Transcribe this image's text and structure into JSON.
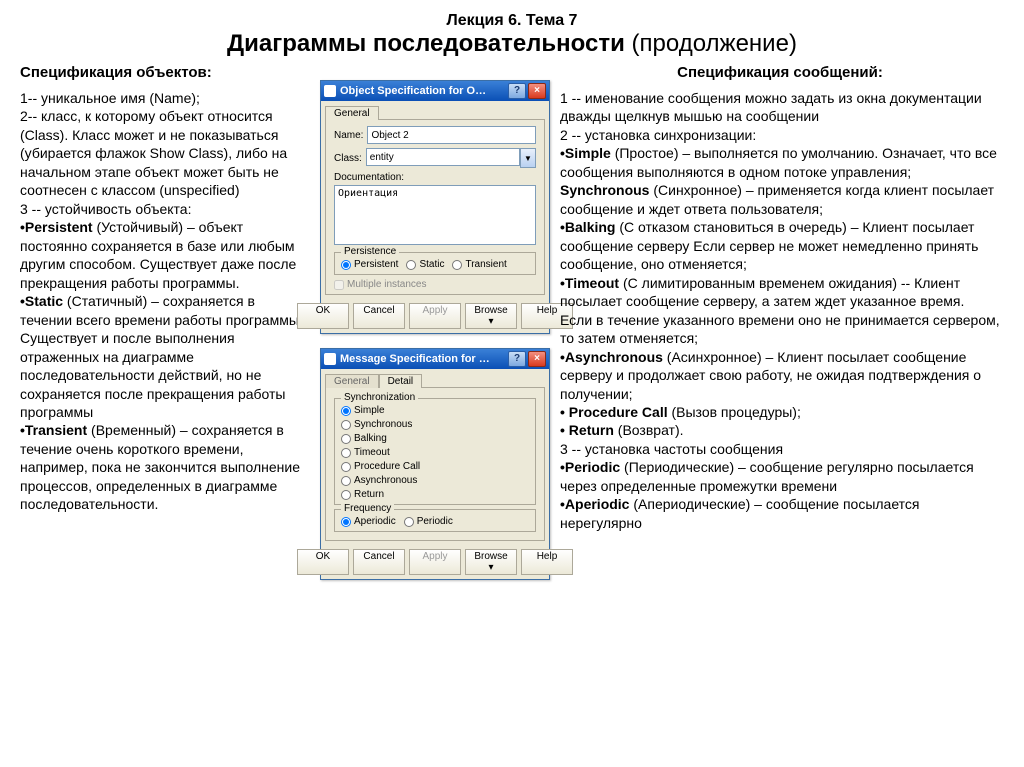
{
  "header": {
    "lecture": "Лекция 6. Тема 7",
    "title_bold": "Диаграммы последовательности",
    "title_rest": " (продолжение)"
  },
  "left": {
    "heading": "Спецификация объектов:",
    "p1": "1-- уникальное имя (Name);",
    "p2": "2-- класс, к которому объект относится (Class). Класс может и не показываться (убирается флажок Show Class), либо на начальном этапе объект может быть не соотнесен с классом (unspecified)",
    "p3": "3 -- устойчивость объекта:",
    "pers_b": "•Persistent",
    "pers_t": " (Устойчивый) – объект постоянно сохраняется в базе или любым другим способом. Существует даже после прекращения работы программы.",
    "stat_b": "•Static",
    "stat_t": " (Статичный) – сохраняется в течении всего времени работы программы. Существует и после выполнения отраженных на диаграмме последовательности действий, но не сохраняется после прекращения работы программы",
    "tran_b": "•Transient",
    "tran_t": " (Временный) – сохраняется в течение очень короткого времени, например, пока не закончится выполнение процессов, определенных в диаграмме последовательности."
  },
  "right": {
    "heading": "Спецификация сообщений:",
    "p1": "1 -- именование сообщения можно задать из окна документации дважды щелкнув мышью на сообщении",
    "p2": "2 -- установка синхронизации:",
    "simp_b": "•Simple",
    "simp_t": " (Простое) – выполняется по умолчанию. Означает, что все сообщения выполняются в одном потоке управления;",
    "sync_b": "Synchronous",
    "sync_t": " (Синхронное) – применяется когда клиент посылает сообщение и ждет ответа пользователя;",
    "balk_b": "•Balking",
    "balk_t": " (С отказом становиться в очередь) – Клиент посылает сообщение серверу Если сервер не может немедленно принять сообщение, оно отменяется;",
    "time_b": "•Timeout",
    "time_t": " (С лимитированным временем ожидания) -- Клиент посылает сообщение серверу, а затем ждет указанное время. Если в течение указанного времени оно не принимается сервером, то затем отменяется;",
    "asyn_b": "•Asynchronous",
    "asyn_t": " (Асинхронное) – Клиент посылает сообщение серверу и продолжает свою работу, не ожидая подтверждения о получении;",
    "proc_b": "• Procedure Call",
    "proc_t": " (Вызов процедуры);",
    "ret_b": "• Return",
    "ret_t": " (Возврат).",
    "p3": "3 -- установка частоты сообщения",
    "per_b": "•Periodic",
    "per_t": " (Периодические) – сообщение регулярно посылается через определенные промежутки времени",
    "aper_b": "•Aperiodic",
    "aper_t": " (Апериодические) – сообщение посылается нерегулярно"
  },
  "win1": {
    "title": "Object Specification for O…",
    "tab": "General",
    "name_lbl": "Name:",
    "name_val": "Object 2",
    "class_lbl": "Class:",
    "class_val": "entity",
    "doc_lbl": "Documentation:",
    "doc_val": "Ориентация",
    "pers_legend": "Persistence",
    "r_pers": "Persistent",
    "r_stat": "Static",
    "r_tran": "Transient",
    "chk": "Multiple instances",
    "btn_ok": "OK",
    "btn_cancel": "Cancel",
    "btn_apply": "Apply",
    "btn_browse": "Browse ▾",
    "btn_help": "Help"
  },
  "win2": {
    "title": "Message Specification for …",
    "tab_general": "General",
    "tab_detail": "Detail",
    "sync_legend": "Synchronization",
    "r_simple": "Simple",
    "r_sync": "Synchronous",
    "r_balk": "Balking",
    "r_timeout": "Timeout",
    "r_proc": "Procedure Call",
    "r_async": "Asynchronous",
    "r_return": "Return",
    "freq_legend": "Frequency",
    "r_aper": "Aperiodic",
    "r_per": "Periodic",
    "btn_ok": "OK",
    "btn_cancel": "Cancel",
    "btn_apply": "Apply",
    "btn_browse": "Browse ▾",
    "btn_help": "Help"
  }
}
